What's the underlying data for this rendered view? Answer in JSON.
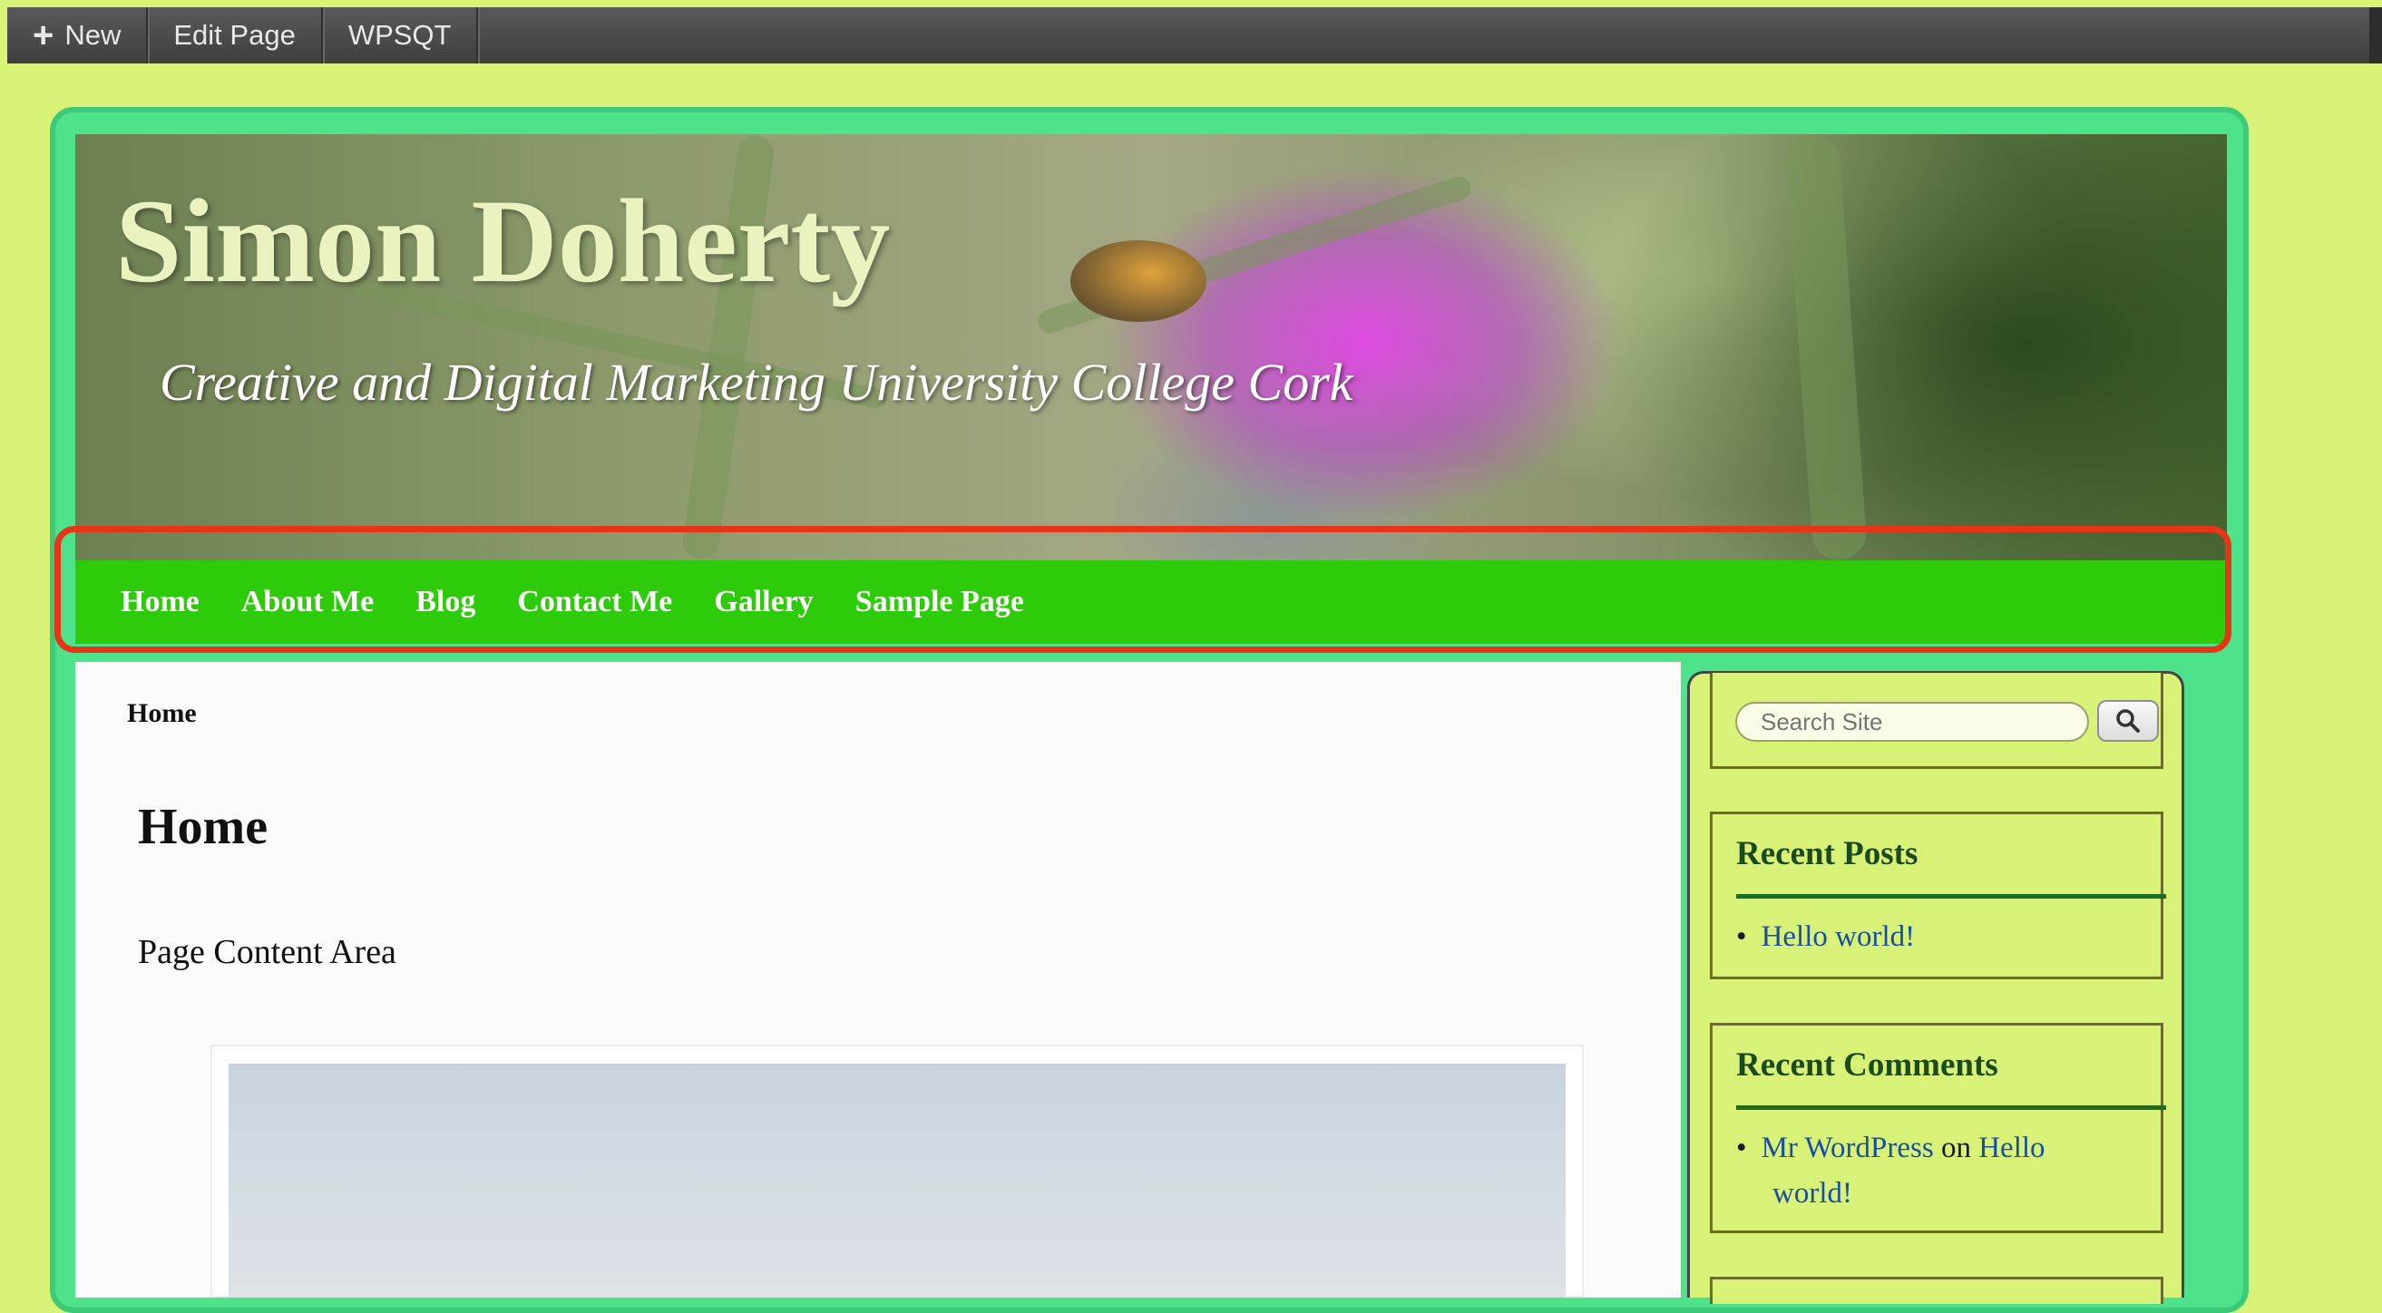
{
  "admin_bar": {
    "items": [
      {
        "label": "New",
        "icon": "plus-icon"
      },
      {
        "label": "Edit Page"
      },
      {
        "label": "WPSQT"
      }
    ]
  },
  "site": {
    "title": "Simon Doherty",
    "tagline": "Creative and Digital Marketing University College Cork"
  },
  "nav": {
    "items": [
      "Home",
      "About Me",
      "Blog",
      "Contact Me",
      "Gallery",
      "Sample Page"
    ],
    "highlight_color": "#e63518"
  },
  "content": {
    "breadcrumb": "Home",
    "title": "Home",
    "text": "Page Content Area"
  },
  "sidebar": {
    "search": {
      "placeholder": "Search Site",
      "icon": "search-icon"
    },
    "recent_posts": {
      "title": "Recent Posts",
      "items": [
        "Hello world!"
      ]
    },
    "recent_comments": {
      "title": "Recent Comments",
      "author": "Mr WordPress",
      "connector": "on",
      "post_line1": "Hello",
      "post_line2": "world!"
    }
  },
  "colors": {
    "page_bg": "#d8f278",
    "frame": "#4ee38a",
    "nav_bg": "#2ecb0a",
    "link": "#1a4fa0"
  }
}
